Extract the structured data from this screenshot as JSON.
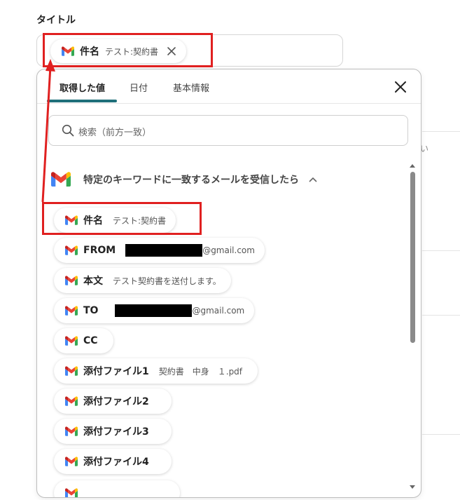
{
  "field": {
    "label": "タイトル"
  },
  "title_chip": {
    "key": "件名",
    "value": "テスト:契約書"
  },
  "popup": {
    "tabs": [
      {
        "label": "取得した値"
      },
      {
        "label": "日付"
      },
      {
        "label": "基本情報"
      }
    ],
    "search_placeholder": "検索（前方一致）",
    "section_title": "特定のキーワードに一致するメールを受信したら",
    "items": [
      {
        "key": "件名",
        "value": "テスト:契約書"
      },
      {
        "key": "FROM",
        "value": "@gmail.com"
      },
      {
        "key": "本文",
        "value": "テスト契約書を送付します。"
      },
      {
        "key": "TO",
        "value": "@gmail.com"
      },
      {
        "key": "CC",
        "value": ""
      },
      {
        "key": "添付ファイル1",
        "value": "契約書　中身　１.pdf"
      },
      {
        "key": "添付ファイル2",
        "value": ""
      },
      {
        "key": "添付ファイル3",
        "value": ""
      },
      {
        "key": "添付ファイル4",
        "value": ""
      }
    ]
  },
  "colors": {
    "accent": "#1f6f7a",
    "annotation": "#e02020"
  },
  "edge_text": "い"
}
